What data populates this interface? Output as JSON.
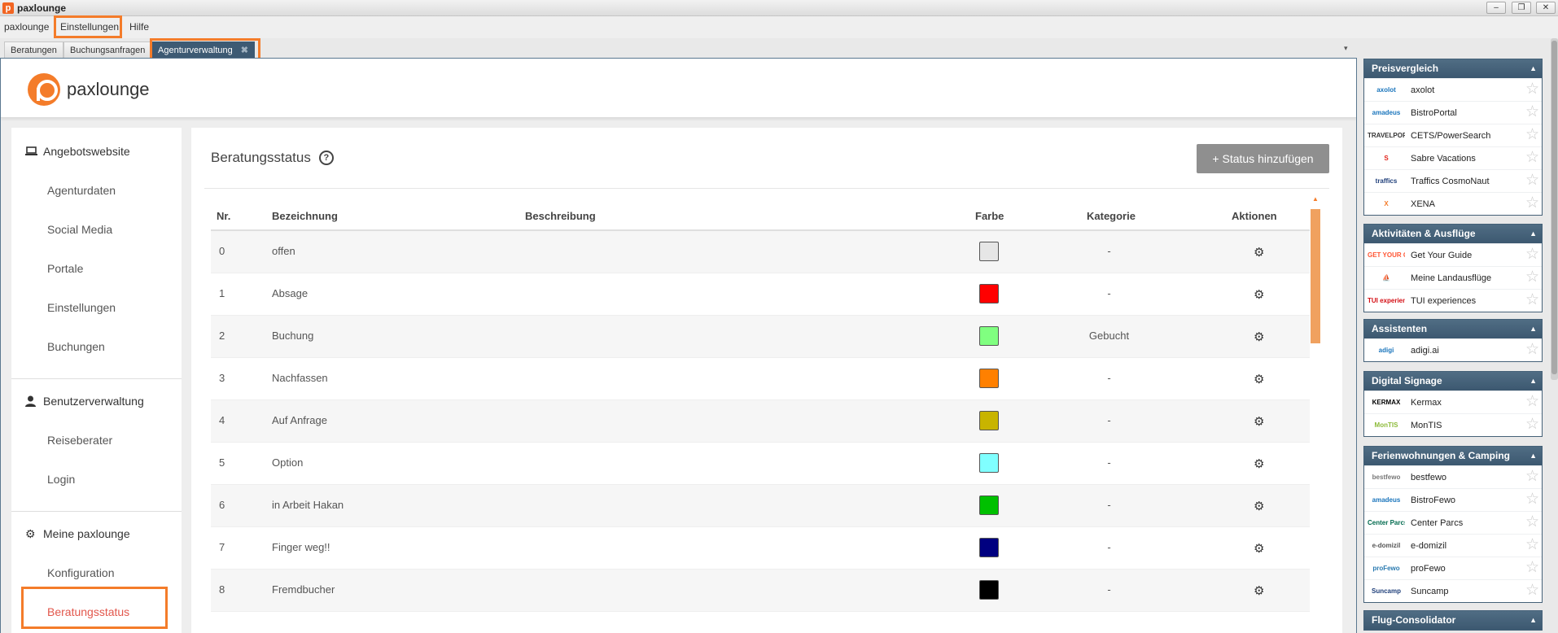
{
  "window": {
    "title": "paxlounge"
  },
  "menubar": {
    "items": [
      "paxlounge",
      "Einstellungen",
      "Hilfe"
    ]
  },
  "tabs": [
    "Beratungen",
    "Buchungsanfragen",
    "Agenturverwaltung"
  ],
  "brand": {
    "name": "paxlounge",
    "accent": "#f47c2a"
  },
  "nav": {
    "sections": [
      {
        "title": "Angebotswebsite",
        "icon": "laptop-icon",
        "items": [
          "Agenturdaten",
          "Social Media",
          "Portale",
          "Einstellungen",
          "Buchungen"
        ]
      },
      {
        "title": "Benutzerverwaltung",
        "icon": "user-icon",
        "items": [
          "Reiseberater",
          "Login"
        ]
      },
      {
        "title": "Meine paxlounge",
        "icon": "gear-icon",
        "items": [
          "Konfiguration",
          "Beratungsstatus"
        ]
      }
    ],
    "active": "Beratungsstatus"
  },
  "content": {
    "title": "Beratungsstatus",
    "help_icon": "?",
    "add_button": "+ Status hinzufügen",
    "columns": [
      "Nr.",
      "Bezeichnung",
      "Beschreibung",
      "Farbe",
      "Kategorie",
      "Aktionen"
    ],
    "rows": [
      {
        "nr": "0",
        "name": "offen",
        "desc": "",
        "color": "#e6e6e6",
        "category": "-"
      },
      {
        "nr": "1",
        "name": "Absage",
        "desc": "",
        "color": "#ff0000",
        "category": "-"
      },
      {
        "nr": "2",
        "name": "Buchung",
        "desc": "",
        "color": "#80ff80",
        "category": "Gebucht"
      },
      {
        "nr": "3",
        "name": "Nachfassen",
        "desc": "",
        "color": "#ff8000",
        "category": "-"
      },
      {
        "nr": "4",
        "name": "Auf Anfrage",
        "desc": "",
        "color": "#c8b400",
        "category": "-"
      },
      {
        "nr": "5",
        "name": "Option",
        "desc": "",
        "color": "#80ffff",
        "category": "-"
      },
      {
        "nr": "6",
        "name": "in Arbeit Hakan",
        "desc": "",
        "color": "#00c000",
        "category": "-"
      },
      {
        "nr": "7",
        "name": "Finger weg!!",
        "desc": "",
        "color": "#000080",
        "category": "-"
      },
      {
        "nr": "8",
        "name": "Fremdbucher",
        "desc": "",
        "color": "#000000",
        "category": "-"
      }
    ]
  },
  "rightpanel": {
    "groups": [
      {
        "title": "Preisvergleich",
        "items": [
          {
            "logo": "axolot",
            "label": "axolot",
            "color": "#1a75bc"
          },
          {
            "logo": "amadeus",
            "label": "BistroPortal",
            "color": "#1a75bc"
          },
          {
            "logo": "TRAVELPORT",
            "label": "CETS/PowerSearch",
            "color": "#333333"
          },
          {
            "logo": "S",
            "label": "Sabre Vacations",
            "color": "#e2231a"
          },
          {
            "logo": "traffics",
            "label": "Traffics CosmoNaut",
            "color": "#1f3f7a"
          },
          {
            "logo": "X",
            "label": "XENA",
            "color": "#f47c2a"
          }
        ]
      },
      {
        "title": "Aktivitäten & Ausflüge",
        "items": [
          {
            "logo": "GET YOUR GUIDE",
            "label": "Get Your Guide",
            "color": "#ff5533"
          },
          {
            "logo": "⛵",
            "label": "Meine Landausflüge",
            "color": "#f5a623"
          },
          {
            "logo": "TUI experiences",
            "label": "TUI experiences",
            "color": "#d40e14"
          }
        ]
      },
      {
        "title": "Assistenten",
        "items": [
          {
            "logo": "adigi",
            "label": "adigi.ai",
            "color": "#1a75bc"
          }
        ]
      },
      {
        "title": "Digital Signage",
        "items": [
          {
            "logo": "KERMAX",
            "label": "Kermax",
            "color": "#000000"
          },
          {
            "logo": "MonTIS",
            "label": "MonTIS",
            "color": "#8dbb3a"
          }
        ]
      },
      {
        "title": "Ferienwohnungen & Camping",
        "items": [
          {
            "logo": "bestfewo",
            "label": "bestfewo",
            "color": "#777777"
          },
          {
            "logo": "amadeus",
            "label": "BistroFewo",
            "color": "#1a75bc"
          },
          {
            "logo": "Center Parcs",
            "label": "Center Parcs",
            "color": "#006a4e"
          },
          {
            "logo": "e-domizil",
            "label": "e-domizil",
            "color": "#555555"
          },
          {
            "logo": "proFewo",
            "label": "proFewo",
            "color": "#2a7ab0"
          },
          {
            "logo": "Suncamp",
            "label": "Suncamp",
            "color": "#1f3f7a"
          }
        ]
      },
      {
        "title": "Flug-Consolidator",
        "items": []
      }
    ]
  }
}
